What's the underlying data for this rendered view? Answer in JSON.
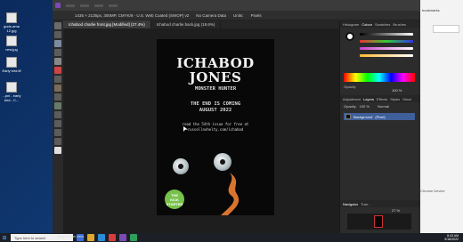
{
  "desktop": {
    "icons": [
      {
        "label": "gods-ama\n12.jpg"
      },
      {
        "label": "new.jpg"
      },
      {
        "label": "Early bird.tif"
      },
      {
        "label": "...pni - early\nbird - C..."
      }
    ]
  },
  "browser": {
    "tab_label": "bookmarks",
    "side_text": "Chrome Device"
  },
  "app": {
    "status": {
      "dimensions": "1435 × 2135px, 300MP, CMYK/8 - U.S. Web Coated (SWOP) v2",
      "camera": "No Camera Data",
      "units_label": "Units:",
      "units_value": "Pixels"
    },
    "doc_tabs": [
      {
        "label": "Ichabod charlie front.jpg [Modified] (27.4%)",
        "active": true
      },
      {
        "label": "Ichabod charlie back.jpg (18.6%)",
        "active": false
      }
    ],
    "artwork": {
      "title_line1": "ICHABOD",
      "title_line2": "JONES",
      "subtitle": "MONSTER HUNTER",
      "announce_line1": "THE END IS COMING",
      "announce_line2": "AUGUST 2022",
      "read_line1": "read the 54th issue for free at",
      "read_line2": "russellnohelty.com/ichabod",
      "badge_line1": "THE",
      "badge_line2": "KICK",
      "badge_line3": "STARTER"
    },
    "right_panel": {
      "top_tabs": [
        "Histogram",
        "Colour",
        "Swatches",
        "Brushes"
      ],
      "opacity_label": "Opacity",
      "opacity_value": "100 %",
      "layer_tabs": [
        "Adjustment",
        "Layers",
        "Effects",
        "Styles",
        "Stock"
      ],
      "layer_opacity_label": "Opacity:",
      "layer_opacity_value": "100 %",
      "blend_mode": "Normal",
      "layer_name": "Background",
      "layer_type": "(Pixel)",
      "nav_tabs": [
        "Navigator",
        "Tran..."
      ],
      "zoom_value": "27 %"
    }
  },
  "taskbar": {
    "search_placeholder": "Type here to search",
    "drag_hint": "Drag to pan view.",
    "time": "8:43 AM",
    "date": "5/18/2022"
  },
  "colors": {
    "accent_blue": "#3e5f99",
    "badge_green": "#77c24a",
    "flame_orange": "#d9742f"
  }
}
